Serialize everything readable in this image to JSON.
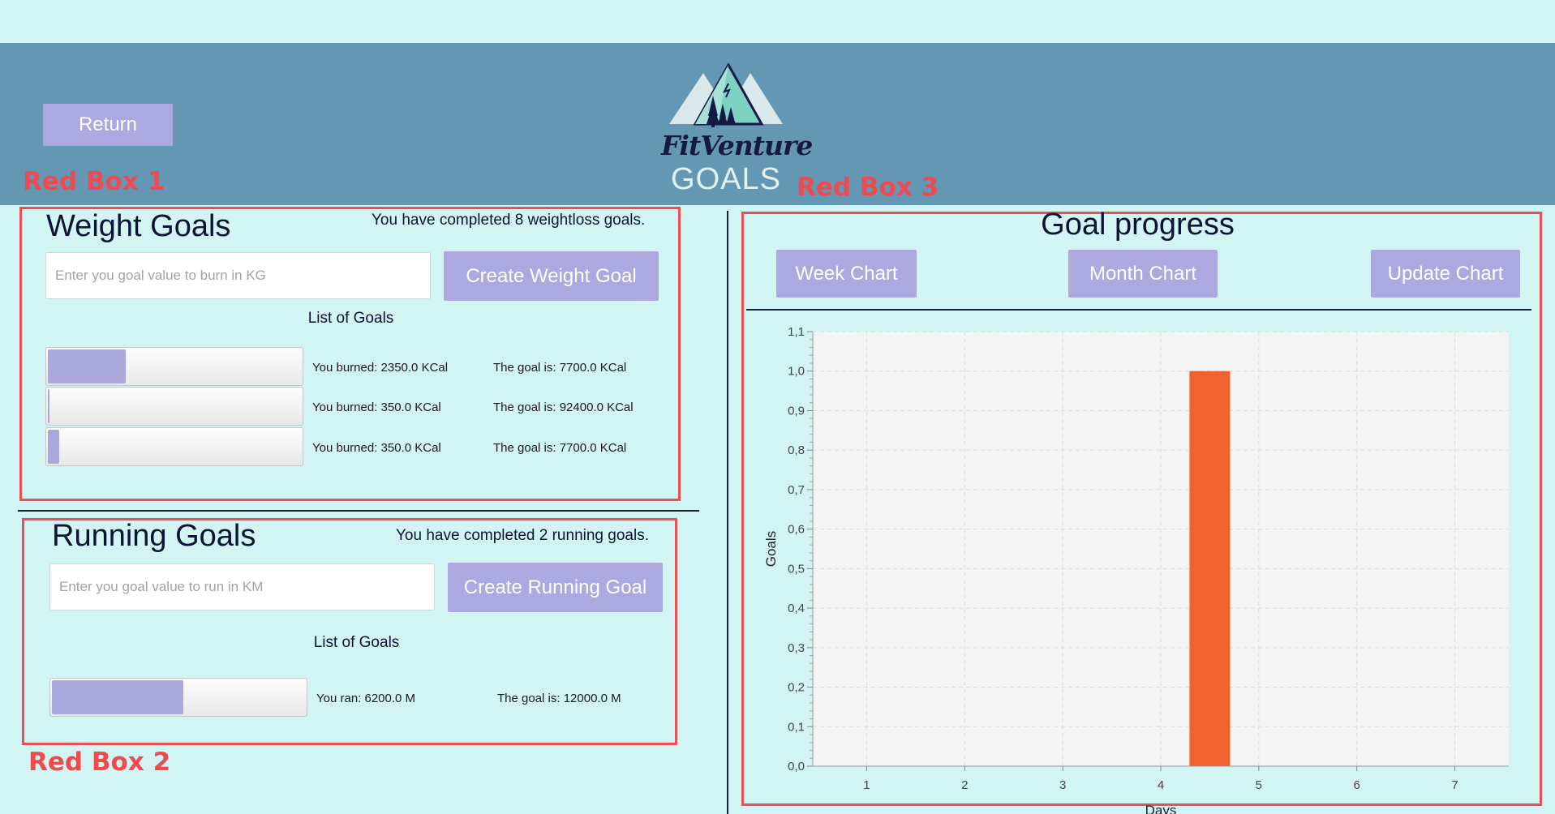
{
  "header": {
    "return_label": "Return",
    "logo_text": "FitVenture",
    "page_title": "GOALS"
  },
  "annotations": [
    "Red Box 1",
    "Red Box 2",
    "Red Box 3"
  ],
  "weight_goals": {
    "title": "Weight Goals",
    "status": "You have completed 8 weightloss goals.",
    "input_placeholder": "Enter you goal value to burn in KG",
    "create_label": "Create Weight Goal",
    "list_label": "List of Goals",
    "items": [
      {
        "progress": 0.305,
        "burned": "You burned: 2350.0 KCal",
        "goal": "The goal is: 7700.0 KCal"
      },
      {
        "progress": 0.004,
        "burned": "You burned: 350.0 KCal",
        "goal": "The goal is: 92400.0 KCal"
      },
      {
        "progress": 0.045,
        "burned": "You burned: 350.0 KCal",
        "goal": "The goal is: 7700.0 KCal"
      }
    ]
  },
  "running_goals": {
    "title": "Running Goals",
    "status": "You have completed 2 running goals.",
    "input_placeholder": "Enter you goal value to run in KM",
    "create_label": "Create Running Goal",
    "list_label": "List of Goals",
    "items": [
      {
        "progress": 0.517,
        "ran": "You ran: 6200.0 M",
        "goal": "The goal is: 12000.0 M"
      }
    ]
  },
  "goal_progress": {
    "title": "Goal progress",
    "buttons": {
      "week": "Week Chart",
      "month": "Month Chart",
      "update": "Update Chart"
    }
  },
  "colors": {
    "background": "#d2f4f3",
    "header": "#6497b3",
    "button": "#aca9e0",
    "accent_red": "#ec4f52",
    "bar": "#f0622e"
  },
  "chart_data": {
    "type": "bar",
    "categories": [
      "1",
      "2",
      "3",
      "4",
      "5",
      "6",
      "7"
    ],
    "values": [
      0,
      0,
      0,
      0,
      1.0,
      0,
      0
    ],
    "xlabel": "Days",
    "ylabel": "Goals",
    "ylim": [
      0,
      1.1
    ],
    "yticks": [
      "0,0",
      "0,1",
      "0,2",
      "0,3",
      "0,4",
      "0,5",
      "0,6",
      "0,7",
      "0,8",
      "0,9",
      "1,0",
      "1,1"
    ],
    "grid": true,
    "bar_color": "#f0622e"
  }
}
